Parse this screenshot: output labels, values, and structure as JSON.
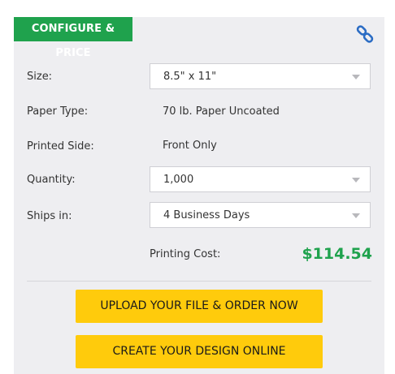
{
  "header": {
    "badge": "CONFIGURE & PRICE",
    "link_icon": "link-icon"
  },
  "form": {
    "size": {
      "label": "Size:",
      "value": "8.5\" x 11\""
    },
    "paper_type": {
      "label": "Paper Type:",
      "value": "70 lb. Paper Uncoated"
    },
    "printed_side": {
      "label": "Printed Side:",
      "value": "Front Only"
    },
    "quantity": {
      "label": "Quantity:",
      "value": "1,000"
    },
    "ships_in": {
      "label": "Ships in:",
      "value": "4 Business Days"
    }
  },
  "cost": {
    "label": "Printing Cost:",
    "value": "$114.54"
  },
  "actions": {
    "upload": "UPLOAD YOUR FILE & ORDER NOW",
    "design": "CREATE YOUR DESIGN ONLINE"
  },
  "colors": {
    "accent_green": "#1fa24d",
    "button_yellow": "#ffcb0c",
    "panel_bg": "#eeeef1"
  }
}
